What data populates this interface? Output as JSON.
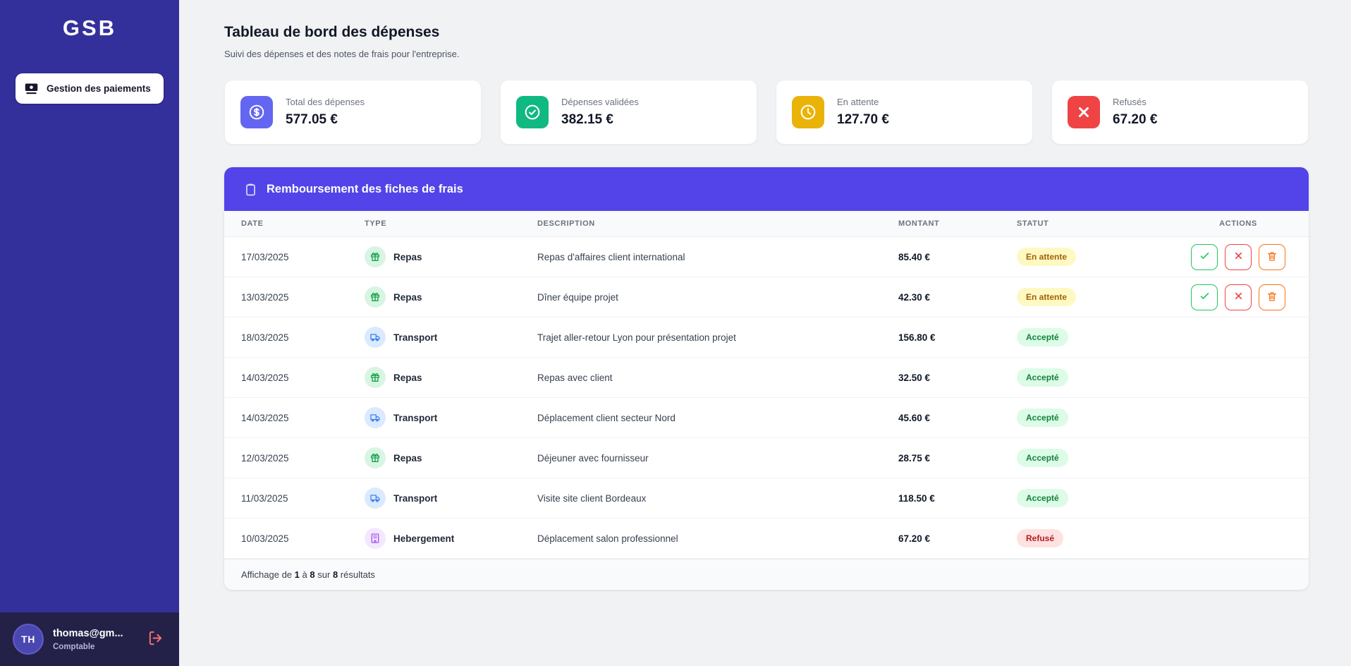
{
  "sidebar": {
    "logo": "GSB",
    "nav_button_label": "Gestion des paiements",
    "nav_button_icon": "banknote-icon",
    "user": {
      "initials": "TH",
      "email": "thomas@gm...",
      "role": "Comptable",
      "logout_icon": "logout-icon"
    }
  },
  "header": {
    "title": "Tableau de bord des dépenses",
    "subtitle": "Suivi des dépenses et des notes de frais pour l'entreprise."
  },
  "stats": [
    {
      "label": "Total des dépenses",
      "value": "577.05 €",
      "icon": "dollar-circle-icon",
      "color": "#6366f1"
    },
    {
      "label": "Dépenses validées",
      "value": "382.15 €",
      "icon": "check-circle-icon",
      "color": "#10b981"
    },
    {
      "label": "En attente",
      "value": "127.70 €",
      "icon": "clock-icon",
      "color": "#eab308"
    },
    {
      "label": "Refusés",
      "value": "67.20 €",
      "icon": "x-icon",
      "color": "#ef4444"
    }
  ],
  "table": {
    "title": "Remboursement des fiches de frais",
    "title_icon": "clipboard-icon",
    "columns": [
      "DATE",
      "TYPE",
      "DESCRIPTION",
      "MONTANT",
      "STATUT",
      "ACTIONS"
    ],
    "type_icons": {
      "Repas": "gift-icon",
      "Transport": "truck-icon",
      "Hebergement": "building-icon"
    },
    "action_icons": [
      "check-icon",
      "x-icon",
      "trash-icon"
    ],
    "rows": [
      {
        "date": "17/03/2025",
        "type": "Repas",
        "description": "Repas d'affaires client international",
        "amount": "85.40 €",
        "status": "En attente",
        "actions": true
      },
      {
        "date": "13/03/2025",
        "type": "Repas",
        "description": "Dîner équipe projet",
        "amount": "42.30 €",
        "status": "En attente",
        "actions": true
      },
      {
        "date": "18/03/2025",
        "type": "Transport",
        "description": "Trajet aller-retour Lyon pour présentation projet",
        "amount": "156.80 €",
        "status": "Accepté",
        "actions": false
      },
      {
        "date": "14/03/2025",
        "type": "Repas",
        "description": "Repas avec client",
        "amount": "32.50 €",
        "status": "Accepté",
        "actions": false
      },
      {
        "date": "14/03/2025",
        "type": "Transport",
        "description": "Déplacement client secteur Nord",
        "amount": "45.60 €",
        "status": "Accepté",
        "actions": false
      },
      {
        "date": "12/03/2025",
        "type": "Repas",
        "description": "Déjeuner avec fournisseur",
        "amount": "28.75 €",
        "status": "Accepté",
        "actions": false
      },
      {
        "date": "11/03/2025",
        "type": "Transport",
        "description": "Visite site client Bordeaux",
        "amount": "118.50 €",
        "status": "Accepté",
        "actions": false
      },
      {
        "date": "10/03/2025",
        "type": "Hebergement",
        "description": "Déplacement salon professionnel",
        "amount": "67.20 €",
        "status": "Refusé",
        "actions": false
      }
    ],
    "footer": {
      "part1": "Affichage de",
      "from": "1",
      "part2": "à",
      "to": "8",
      "part3": "sur",
      "total": "8",
      "part4": "résultats"
    }
  },
  "colors": {
    "sidebar_bg": "#34309b",
    "sidebar_user_bg": "#242149",
    "table_header_bg": "#5244e8",
    "status_pending_bg": "#fef9c3",
    "status_pending_text": "#a16207",
    "status_accepted_bg": "#dcfce7",
    "status_accepted_text": "#15803d",
    "status_refused_bg": "#fee2e2",
    "status_refused_text": "#b91c1c",
    "logout_icon": "#f87171"
  }
}
